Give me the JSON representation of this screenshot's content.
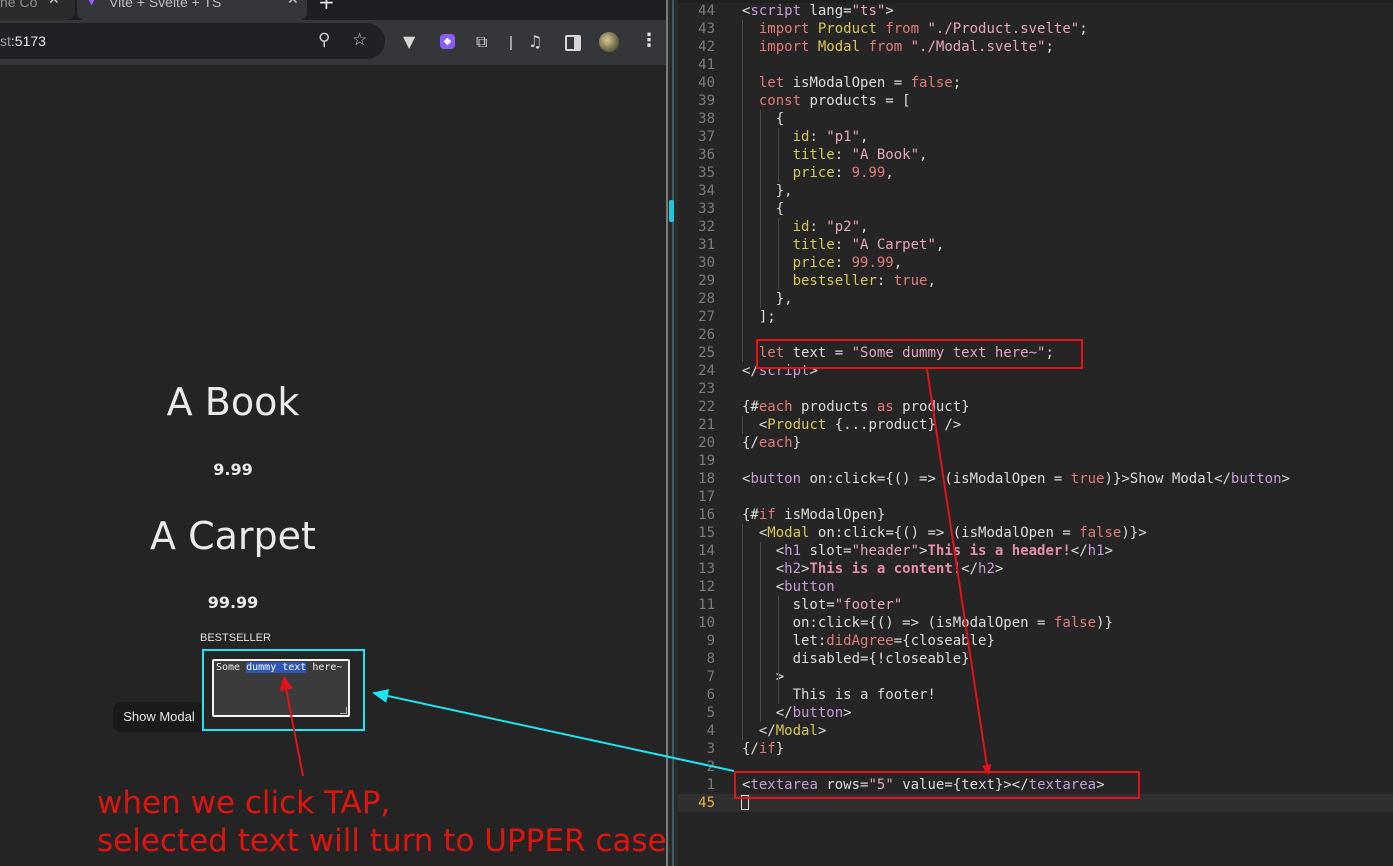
{
  "browser": {
    "tabs": [
      {
        "title": "he Co",
        "close": "✕"
      },
      {
        "title": "Vite + Svelte + TS",
        "close": "✕"
      }
    ],
    "new_tab": "+",
    "url_dim": "st",
    "url_rest": ":5173",
    "icons": [
      "zoom-icon",
      "star-icon",
      "vue-devtools-icon",
      "extension-icon",
      "puzzle-icon",
      "media-icon",
      "sidepanel-icon",
      "avatar",
      "menu-icon"
    ]
  },
  "page": {
    "products": [
      {
        "title": "A Book",
        "price": "9.99"
      },
      {
        "title": "A Carpet",
        "price": "99.99"
      }
    ],
    "bestseller_label": "BESTSELLER",
    "textarea": {
      "before": "Some ",
      "selected": "dummy text",
      "after": " here~"
    },
    "show_modal_label": "Show Modal"
  },
  "annotation": {
    "line1": "when we click TAP,",
    "line2": "selected text will turn to UPPER case"
  },
  "editor": {
    "line_numbers": [
      "44",
      "43",
      "42",
      "41",
      "40",
      "39",
      "38",
      "37",
      "36",
      "35",
      "34",
      "33",
      "32",
      "31",
      "30",
      "29",
      "28",
      "27",
      "26",
      "25",
      "24",
      "23",
      "22",
      "21",
      "20",
      "19",
      "18",
      "17",
      "16",
      "15",
      "14",
      "13",
      "12",
      "11",
      "10",
      "9",
      "8",
      "7",
      "6",
      "5",
      "4",
      "3",
      "2",
      "1",
      "45"
    ],
    "highlighted_line": "45",
    "colors": {
      "keyword": "#e07b79",
      "string": "#e6a6bc",
      "tag": "#c79bd9",
      "annotation": "#e3121b",
      "cyan": "#1de6f2"
    }
  }
}
